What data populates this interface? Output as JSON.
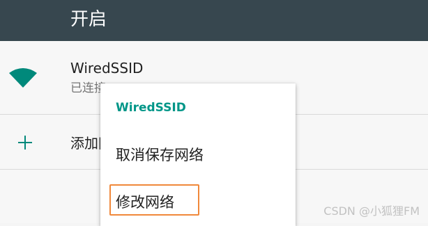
{
  "header": {
    "title": "开启"
  },
  "wifi": {
    "name": "WiredSSID",
    "status": "已连接",
    "icon": "wifi-signal-icon",
    "icon_color": "#00897b"
  },
  "add_network": {
    "icon": "plus-icon",
    "label": "添加网络",
    "icon_color": "#00897b"
  },
  "popup": {
    "title": "WiredSSID",
    "items": [
      {
        "label": "取消保存网络"
      },
      {
        "label": "修改网络",
        "highlighted": true
      }
    ]
  },
  "watermark": "CSDN @小狐狸FM",
  "colors": {
    "header_bg": "#37474f",
    "accent": "#009688",
    "highlight_border": "#f0883a"
  }
}
